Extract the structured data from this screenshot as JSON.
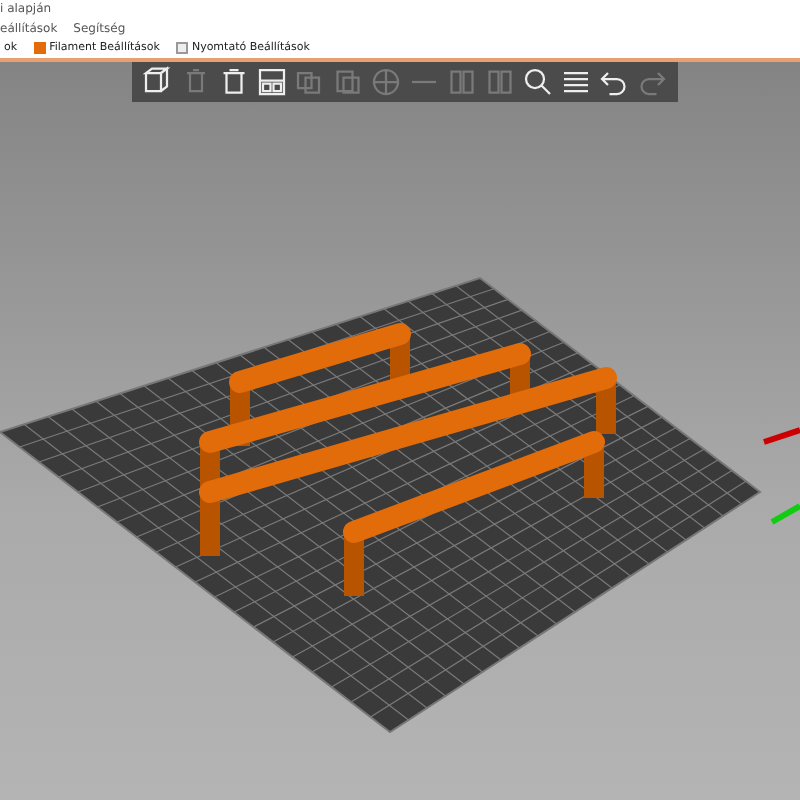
{
  "window": {
    "title": "i alapján"
  },
  "menu": [
    "eállítások",
    "Segítség"
  ],
  "tabs": [
    {
      "label": "ok",
      "selected": false
    },
    {
      "label": "Filament Beállítások",
      "selected": false
    },
    {
      "label": "Nyomtató Beállítások",
      "selected": false
    }
  ],
  "toolbar": [
    {
      "kind": "add",
      "disabled": false
    },
    {
      "kind": "delete",
      "disabled": true
    },
    {
      "kind": "delete-all",
      "disabled": false
    },
    {
      "kind": "arrange",
      "disabled": false
    },
    {
      "kind": "copy",
      "disabled": true
    },
    {
      "kind": "paste",
      "disabled": true
    },
    {
      "kind": "plus",
      "disabled": true
    },
    {
      "kind": "minus",
      "disabled": true
    },
    {
      "kind": "split",
      "disabled": true
    },
    {
      "kind": "split",
      "disabled": true
    },
    {
      "kind": "search",
      "disabled": false
    },
    {
      "kind": "layers",
      "disabled": false
    },
    {
      "kind": "undo",
      "disabled": false
    },
    {
      "kind": "redo",
      "disabled": true
    }
  ]
}
